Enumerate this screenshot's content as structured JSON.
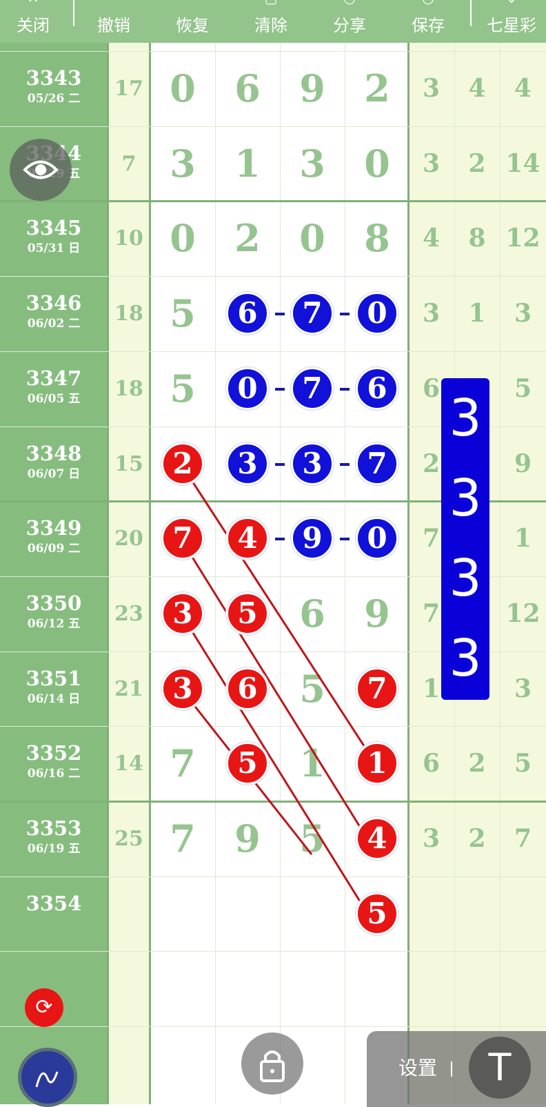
{
  "toolbar": {
    "close": "关闭",
    "undo": "撤销",
    "redo": "恢复",
    "clear": "清除",
    "share": "分享",
    "save": "保存",
    "game": "七星彩"
  },
  "rows": [
    {
      "issue": "3343",
      "date": "05/26 二",
      "sum": "17",
      "digits": [
        "0",
        "6",
        "9",
        "2"
      ],
      "right": [
        "3",
        "4",
        "4"
      ]
    },
    {
      "issue": "3344",
      "date": "05/29 五",
      "sum": "7",
      "digits": [
        "3",
        "1",
        "3",
        "0"
      ],
      "right": [
        "3",
        "2",
        "14"
      ]
    },
    {
      "issue": "3345",
      "date": "05/31 日",
      "sum": "10",
      "digits": [
        "0",
        "2",
        "0",
        "8"
      ],
      "right": [
        "4",
        "8",
        "12"
      ]
    },
    {
      "issue": "3346",
      "date": "06/02 二",
      "sum": "18",
      "digits": [
        "5",
        "6",
        "7",
        "0"
      ],
      "right": [
        "3",
        "1",
        "3"
      ]
    },
    {
      "issue": "3347",
      "date": "06/05 五",
      "sum": "18",
      "digits": [
        "5",
        "0",
        "7",
        "6"
      ],
      "right": [
        "6",
        "",
        "5"
      ]
    },
    {
      "issue": "3348",
      "date": "06/07 日",
      "sum": "15",
      "digits": [
        "2",
        "3",
        "3",
        "7"
      ],
      "right": [
        "2",
        "",
        "9"
      ]
    },
    {
      "issue": "3349",
      "date": "06/09 二",
      "sum": "20",
      "digits": [
        "7",
        "4",
        "9",
        "0"
      ],
      "right": [
        "7",
        "",
        "1"
      ]
    },
    {
      "issue": "3350",
      "date": "06/12 五",
      "sum": "23",
      "digits": [
        "3",
        "5",
        "6",
        "9"
      ],
      "right": [
        "7",
        "",
        "12"
      ]
    },
    {
      "issue": "3351",
      "date": "06/14 日",
      "sum": "21",
      "digits": [
        "3",
        "6",
        "5",
        "7"
      ],
      "right": [
        "1",
        "",
        "3"
      ]
    },
    {
      "issue": "3352",
      "date": "06/16 二",
      "sum": "14",
      "digits": [
        "7",
        "5",
        "1",
        "1"
      ],
      "right": [
        "6",
        "2",
        "5"
      ]
    },
    {
      "issue": "3353",
      "date": "06/19 五",
      "sum": "25",
      "digits": [
        "7",
        "9",
        "5",
        "4"
      ],
      "right": [
        "3",
        "2",
        "7"
      ]
    },
    {
      "issue": "3354",
      "date": "",
      "sum": "",
      "digits": [
        "",
        "",
        "",
        "5"
      ],
      "right": [
        "",
        "",
        ""
      ]
    }
  ],
  "highlight_digits": [
    "3",
    "3",
    "3",
    "3"
  ],
  "settings_label": "设置",
  "settings_button": "T",
  "colors": {
    "blue_ball": "#1111d9",
    "red_ball": "#e81515",
    "header_green": "#93c48b",
    "digit_green": "#96c490"
  }
}
